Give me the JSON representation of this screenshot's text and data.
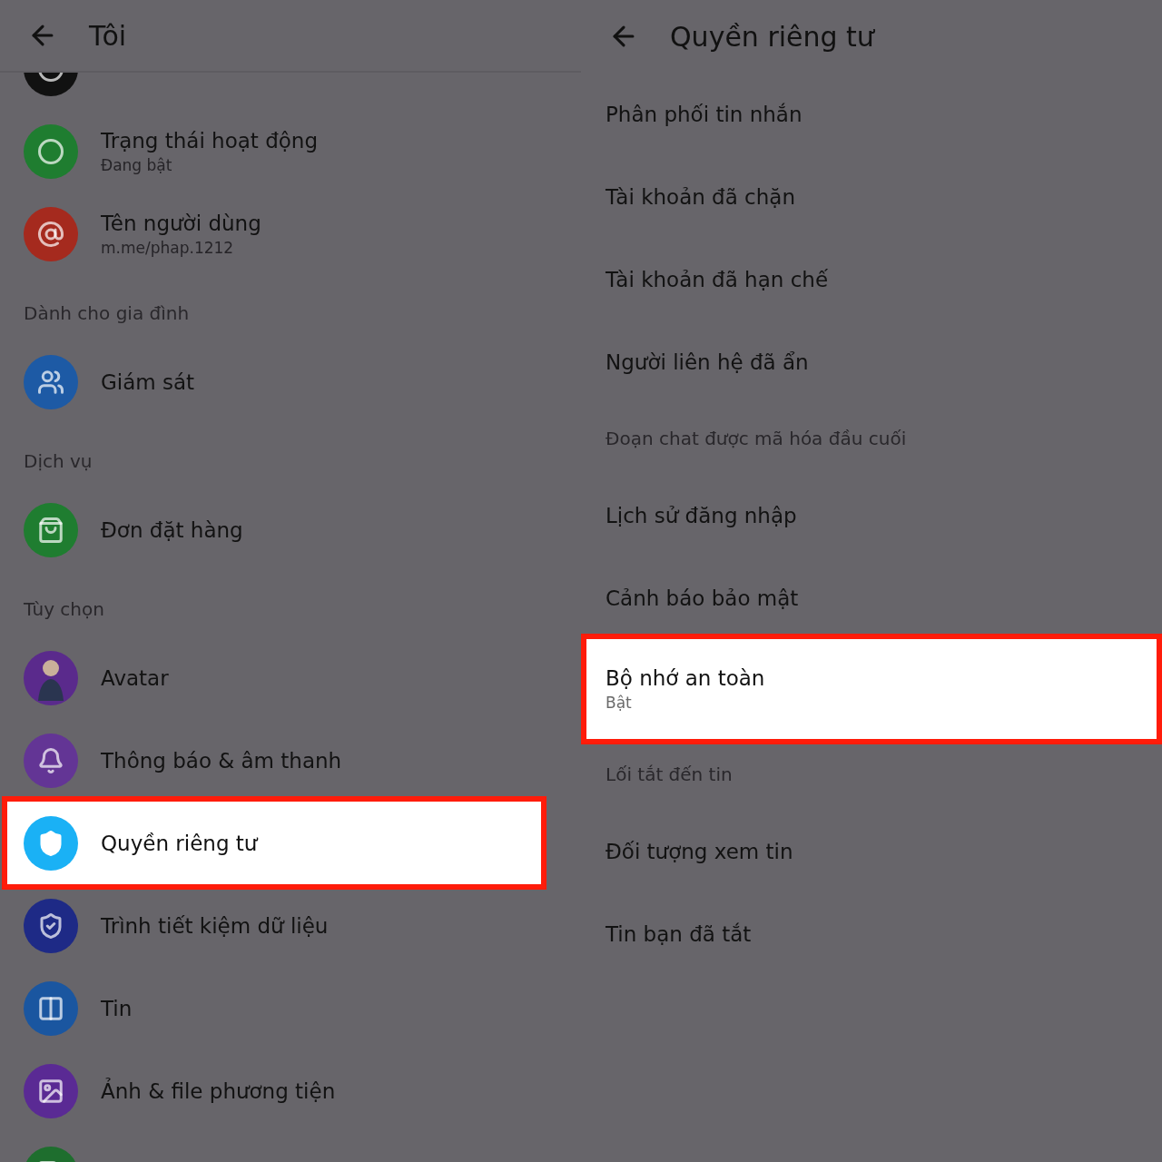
{
  "left_screen": {
    "title": "Tôi",
    "items": [
      {
        "kind": "partial_top",
        "color": "#111111"
      },
      {
        "kind": "item",
        "title": "Trạng thái hoạt động",
        "subtitle": "Đang bật",
        "color": "#1f7d30",
        "highlighted": false
      },
      {
        "kind": "item",
        "title": "Tên người dùng",
        "subtitle": "m.me/phap.1212",
        "color": "#a52a1e",
        "highlighted": false
      },
      {
        "kind": "section",
        "title": "Dành cho gia đình"
      },
      {
        "kind": "item",
        "title": "Giám sát",
        "color": "#1d5aa5",
        "highlighted": false
      },
      {
        "kind": "section",
        "title": "Dịch vụ"
      },
      {
        "kind": "item",
        "title": "Đơn đặt hàng",
        "color": "#1f7d30",
        "highlighted": false
      },
      {
        "kind": "section",
        "title": "Tùy chọn"
      },
      {
        "kind": "item",
        "title": "Avatar",
        "color": "#5a2a8c",
        "highlighted": false
      },
      {
        "kind": "item",
        "title": "Thông báo & âm thanh",
        "color": "#633595",
        "highlighted": false
      },
      {
        "kind": "item",
        "title": "Quyền riêng tư",
        "color": "#1ab1f5",
        "highlighted": true
      },
      {
        "kind": "item",
        "title": "Trình tiết kiệm dữ liệu",
        "color": "#1e2a86",
        "highlighted": false
      },
      {
        "kind": "item",
        "title": "Tin",
        "color": "#1a56a0",
        "highlighted": false
      },
      {
        "kind": "item",
        "title": "Ảnh & file phương tiện",
        "color": "#5a2a94",
        "highlighted": false
      },
      {
        "kind": "partial_bottom",
        "color": "#1e6e2e"
      }
    ]
  },
  "right_screen": {
    "title": "Quyền riêng tư",
    "items": [
      {
        "kind": "item",
        "title": "Phân phối tin nhắn",
        "highlighted": false
      },
      {
        "kind": "item",
        "title": "Tài khoản đã chặn",
        "highlighted": false
      },
      {
        "kind": "item",
        "title": "Tài khoản đã hạn chế",
        "highlighted": false
      },
      {
        "kind": "item",
        "title": "Người liên hệ đã ẩn",
        "highlighted": false
      },
      {
        "kind": "section",
        "title": "Đoạn chat được mã hóa đầu cuối"
      },
      {
        "kind": "item",
        "title": "Lịch sử đăng nhập",
        "highlighted": false
      },
      {
        "kind": "item",
        "title": "Cảnh báo bảo mật",
        "highlighted": false
      },
      {
        "kind": "item",
        "title": "Bộ nhớ an toàn",
        "subtitle": "Bật",
        "highlighted": true
      },
      {
        "kind": "section",
        "title": "Lối tắt đến tin"
      },
      {
        "kind": "item",
        "title": "Đối tượng xem tin",
        "highlighted": false
      },
      {
        "kind": "item",
        "title": "Tin bạn đã tắt",
        "highlighted": false
      }
    ]
  }
}
